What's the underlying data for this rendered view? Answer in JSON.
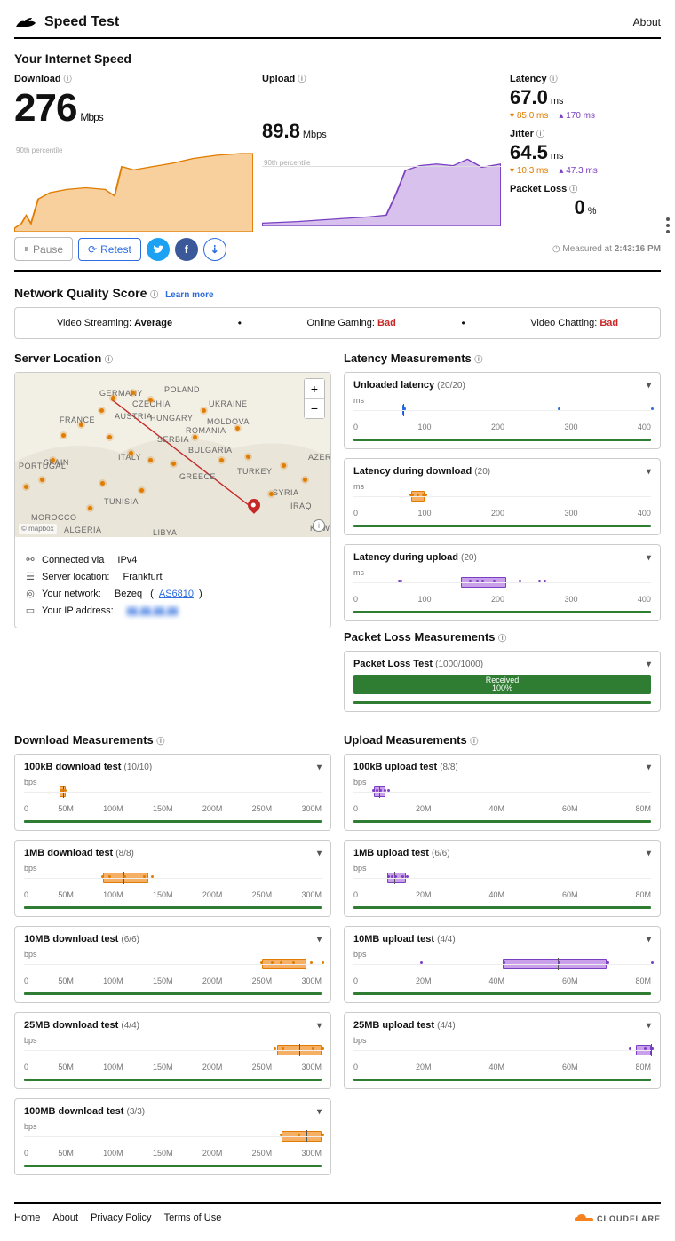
{
  "header": {
    "title": "Speed Test",
    "about": "About"
  },
  "section_titles": {
    "your_speed": "Your Internet Speed",
    "nqs": "Network Quality Score",
    "server_location": "Server Location",
    "latency_meas": "Latency Measurements",
    "packet_loss_meas": "Packet Loss Measurements",
    "download_meas": "Download Measurements",
    "upload_meas": "Upload Measurements"
  },
  "summary": {
    "download": {
      "label": "Download",
      "value": "276",
      "unit": "Mbps",
      "pct90": "90th percentile"
    },
    "upload": {
      "label": "Upload",
      "value": "89.8",
      "unit": "Mbps",
      "pct90": "90th percentile"
    },
    "latency": {
      "label": "Latency",
      "value": "67.0",
      "unit": "ms",
      "dl": "85.0 ms",
      "ul": "170 ms"
    },
    "jitter": {
      "label": "Jitter",
      "value": "64.5",
      "unit": "ms",
      "dl": "10.3 ms",
      "ul": "47.3 ms"
    },
    "packet_loss": {
      "label": "Packet Loss",
      "value": "0",
      "unit": "%"
    }
  },
  "actions": {
    "pause": "Pause",
    "retest": "Retest",
    "measured_prefix": "Measured at",
    "measured_time": "2:43:16 PM"
  },
  "nqs": {
    "learn": "Learn more",
    "streaming_label": "Video Streaming:",
    "streaming_val": "Average",
    "gaming_label": "Online Gaming:",
    "gaming_val": "Bad",
    "chatting_label": "Video Chatting:",
    "chatting_val": "Bad"
  },
  "map_countries": [
    "GERMANY",
    "POLAND",
    "CZECHIA",
    "AUSTRIA",
    "HUNGARY",
    "UKRAINE",
    "MOLDOVA",
    "ROMANIA",
    "SERBIA",
    "BULGARIA",
    "FRANCE",
    "SPAIN",
    "PORTUGAL",
    "ITALY",
    "GREECE",
    "TURKEY",
    "SYRIA",
    "IRAQ",
    "KUWAIT",
    "MOROCCO",
    "ALGERIA",
    "TUNISIA",
    "LIBYA",
    "AZERBAIJAN"
  ],
  "conn": {
    "via_label": "Connected via",
    "via_val": "IPv4",
    "loc_label": "Server location:",
    "loc_val": "Frankfurt",
    "net_label": "Your network:",
    "net_val": "Bezeq",
    "net_as": "AS6810",
    "ip_label": "Your IP address:",
    "ip_val": "▮▮.▮▮.▮▮.▮▮"
  },
  "latency_cards": [
    {
      "title": "Unloaded latency",
      "count": "(20/20)",
      "max": 400,
      "box": [
        66,
        68
      ],
      "median": 67,
      "dots": [
        67,
        67,
        275,
        440
      ],
      "color": "blue"
    },
    {
      "title": "Latency during download",
      "count": "(20)",
      "max": 400,
      "box": [
        78,
        95
      ],
      "median": 85,
      "dots": [
        75,
        78,
        85,
        92,
        95
      ],
      "color": "dl"
    },
    {
      "title": "Latency during upload",
      "count": "(20)",
      "max": 400,
      "box": [
        145,
        205
      ],
      "median": 170,
      "dots": [
        60,
        62,
        155,
        165,
        172,
        188,
        222,
        248,
        255
      ],
      "color": "ul"
    }
  ],
  "packet_loss_card": {
    "title": "Packet Loss Test",
    "count": "(1000/1000)",
    "recv": "Received",
    "pct": "100%"
  },
  "download_cards": [
    {
      "title": "100kB download test",
      "count": "(10/10)",
      "max": 300,
      "box": [
        36,
        42
      ],
      "median": 39,
      "dots": [
        36,
        38,
        40
      ]
    },
    {
      "title": "1MB download test",
      "count": "(8/8)",
      "max": 300,
      "box": [
        80,
        125
      ],
      "median": 100,
      "dots": [
        78,
        85,
        100,
        120,
        128
      ]
    },
    {
      "title": "10MB download test",
      "count": "(6/6)",
      "max": 300,
      "box": [
        240,
        285
      ],
      "median": 260,
      "dots": [
        238,
        249,
        258,
        270,
        288,
        310
      ]
    },
    {
      "title": "25MB download test",
      "count": "(4/4)",
      "max": 300,
      "box": [
        255,
        300
      ],
      "median": 278,
      "dots": [
        252,
        260,
        290,
        342
      ]
    },
    {
      "title": "100MB download test",
      "count": "(3/3)",
      "max": 300,
      "box": [
        260,
        310
      ],
      "median": 285,
      "dots": [
        258,
        276,
        350
      ]
    }
  ],
  "upload_cards": [
    {
      "title": "100kB upload test",
      "count": "(8/8)",
      "max": 80,
      "box": [
        5.5,
        8.5
      ],
      "median": 7,
      "dots": [
        5,
        6,
        7,
        8,
        9
      ]
    },
    {
      "title": "1MB upload test",
      "count": "(6/6)",
      "max": 80,
      "box": [
        9,
        14
      ],
      "median": 11,
      "dots": [
        9,
        10,
        11,
        13,
        14
      ]
    },
    {
      "title": "10MB upload test",
      "count": "(4/4)",
      "max": 80,
      "box": [
        40,
        68
      ],
      "median": 55,
      "dots": [
        18,
        40,
        55,
        68,
        86
      ]
    },
    {
      "title": "25MB upload test",
      "count": "(4/4)",
      "max": 80,
      "box": [
        76,
        88
      ],
      "median": 82,
      "dots": [
        74,
        78,
        84,
        88
      ]
    }
  ],
  "axis_lat": [
    "0",
    "100",
    "200",
    "300",
    "400"
  ],
  "axis_dl": [
    "0",
    "50M",
    "100M",
    "150M",
    "200M",
    "250M",
    "300M"
  ],
  "axis_ul": [
    "0",
    "20M",
    "40M",
    "60M",
    "80M"
  ],
  "unit_ms": "ms",
  "unit_bps": "bps",
  "footer": {
    "links": [
      "Home",
      "About",
      "Privacy Policy",
      "Terms of Use"
    ],
    "brand": "CLOUDFLARE"
  },
  "chart_data": {
    "download_trace": {
      "type": "area",
      "ylabel": "Mbps",
      "values": [
        10,
        15,
        18,
        20,
        40,
        55,
        150,
        165,
        170,
        172,
        168,
        150,
        110,
        175,
        180,
        188,
        192,
        198,
        205,
        212,
        220,
        238,
        250,
        262,
        270,
        276,
        276
      ],
      "note": "90th percentile"
    },
    "upload_trace": {
      "type": "area",
      "ylabel": "Mbps",
      "values": [
        5,
        6,
        6,
        7,
        7,
        8,
        8,
        9,
        9,
        10,
        12,
        15,
        20,
        45,
        70,
        80,
        84,
        86,
        88,
        85,
        92,
        90,
        89,
        89.8
      ],
      "note": "90th percentile"
    }
  }
}
